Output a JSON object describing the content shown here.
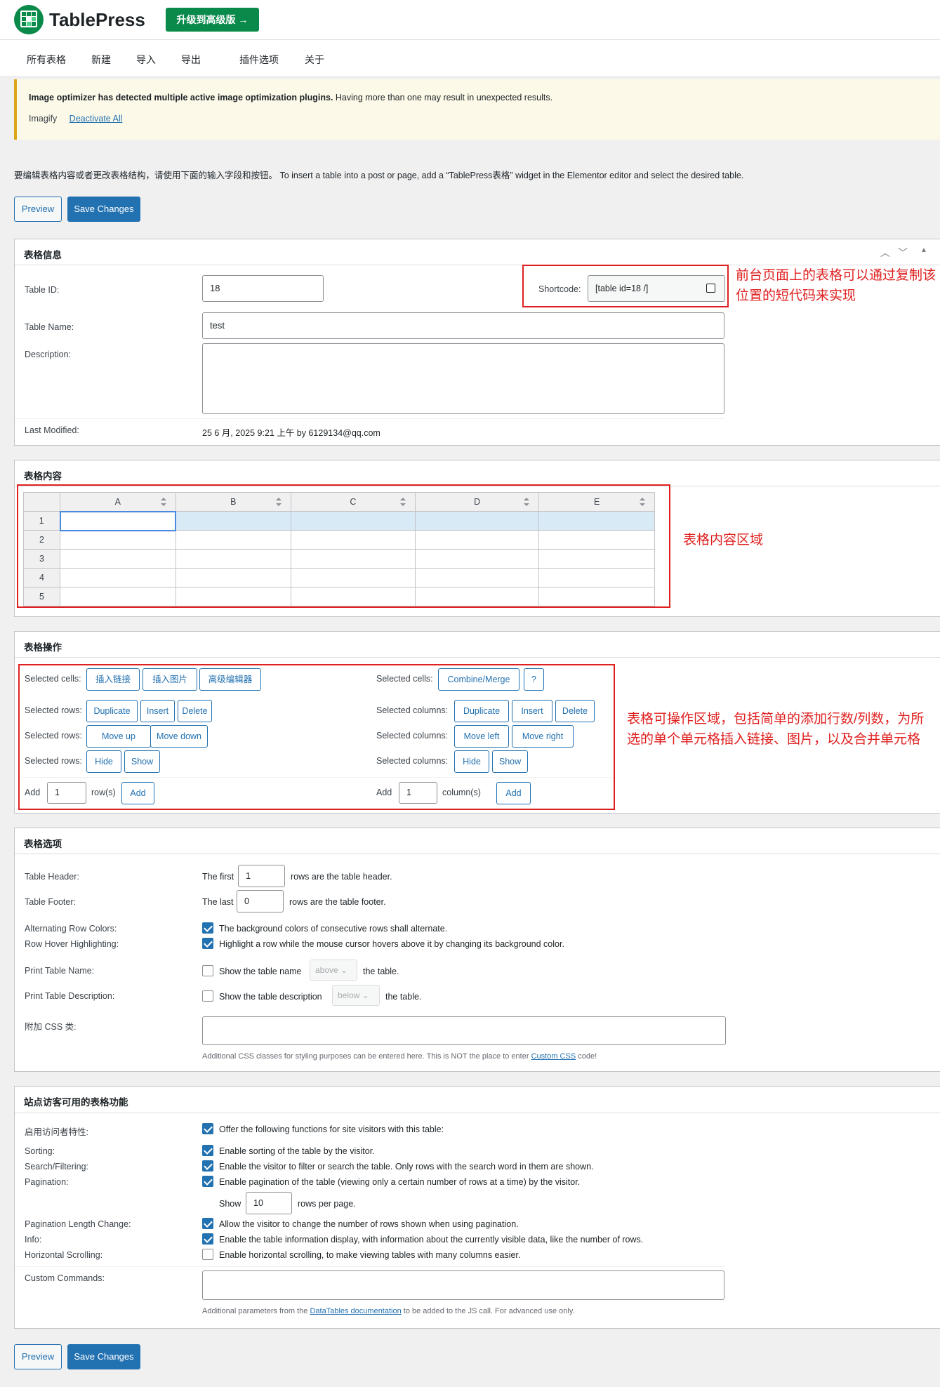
{
  "app": {
    "brand": "TablePress",
    "upgrade_label": "升级到高级版 →"
  },
  "nav": [
    "所有表格",
    "新建",
    "导入",
    "导出",
    "插件选项",
    "关于"
  ],
  "notice": {
    "bold": "Image optimizer has detected multiple active image optimization plugins.",
    "text": " Having more than one may result in unexpected results.",
    "plugin": "Imagify",
    "deactivate": "Deactivate All"
  },
  "intro": "要编辑表格内容或者更改表格结构，请使用下面的输入字段和按钮。 To insert a table into a post or page, add a “TablePress表格” widget in the Elementor editor and select the desired table.",
  "buttons": {
    "preview": "Preview",
    "save": "Save Changes"
  },
  "info": {
    "title": "表格信息",
    "id_label": "Table ID:",
    "id_value": "18",
    "shortcode_label": "Shortcode:",
    "shortcode_value": "[table id=18 /]",
    "name_label": "Table Name:",
    "name_value": "test",
    "desc_label": "Description:",
    "modified_label": "Last Modified:",
    "modified_value": "25 6 月, 2025 9:21 上午 by 6129134@qq.com",
    "annotation": "前台页面上的表格可以通过复制该位置的短代码来实现"
  },
  "content": {
    "title": "表格内容",
    "columns": [
      "A",
      "B",
      "C",
      "D",
      "E"
    ],
    "rows": [
      "1",
      "2",
      "3",
      "4",
      "5"
    ],
    "annotation": "表格内容区域"
  },
  "ops": {
    "title": "表格操作",
    "selected_cells": "Selected cells:",
    "selected_rows": "Selected rows:",
    "selected_columns": "Selected columns:",
    "insert_link": "插入链接",
    "insert_image": "插入图片",
    "advanced_editor": "高级编辑器",
    "combine": "Combine/Merge",
    "help": "?",
    "duplicate": "Duplicate",
    "insert": "Insert",
    "delete": "Delete",
    "move_up": "Move up",
    "move_down": "Move down",
    "move_left": "Move left",
    "move_right": "Move right",
    "hide": "Hide",
    "show": "Show",
    "add": "Add",
    "rows_value": "1",
    "cols_value": "1",
    "rows_suffix": "row(s)",
    "cols_suffix": "column(s)",
    "annotation": "表格可操作区域，包括简单的添加行数/列数，为所选的单个单元格插入链接、图片，以及合并单元格"
  },
  "options": {
    "title": "表格选项",
    "header_label": "Table Header:",
    "header_pre": "The first",
    "header_value": "1",
    "header_post": "rows are the table header.",
    "footer_label": "Table Footer:",
    "footer_pre": "The last",
    "footer_value": "0",
    "footer_post": "rows are the table footer.",
    "alt_label": "Alternating Row Colors:",
    "alt_text": "The background colors of consecutive rows shall alternate.",
    "hover_label": "Row Hover Highlighting:",
    "hover_text": "Highlight a row while the mouse cursor hovers above it by changing its background color.",
    "print_name_label": "Print Table Name:",
    "print_name_text": "Show the table name",
    "print_name_sel": "above",
    "print_name_post": "the table.",
    "print_desc_label": "Print Table Description:",
    "print_desc_text": "Show the table description",
    "print_desc_sel": "below",
    "print_desc_post": "the table.",
    "css_label": "附加 CSS 类:",
    "css_help": "Additional CSS classes for styling purposes can be entered here. This is NOT the place to enter ",
    "css_link": "Custom CSS",
    "css_help_end": " code!"
  },
  "visitor": {
    "title": "站点访客可用的表格功能",
    "enable_label": "启用访问者特性:",
    "enable_text": "Offer the following functions for site visitors with this table:",
    "sorting_label": "Sorting:",
    "sorting_text": "Enable sorting of the table by the visitor.",
    "search_label": "Search/Filtering:",
    "search_text": "Enable the visitor to filter or search the table. Only rows with the search word in them are shown.",
    "pag_label": "Pagination:",
    "pag_text": "Enable pagination of the table (viewing only a certain number of rows at a time) by the visitor.",
    "show_pre": "Show",
    "show_value": "10",
    "show_post": "rows per page.",
    "plc_label": "Pagination Length Change:",
    "plc_text": "Allow the visitor to change the number of rows shown when using pagination.",
    "info_label": "Info:",
    "info_text": "Enable the table information display, with information about the currently visible data, like the number of rows.",
    "hs_label": "Horizontal Scrolling:",
    "hs_text": "Enable horizontal scrolling, to make viewing tables with many columns easier.",
    "cmd_label": "Custom Commands:",
    "cmd_help": "Additional parameters from the ",
    "cmd_link": "DataTables documentation",
    "cmd_help_end": " to be added to the JS call. For advanced use only."
  },
  "colors": {
    "accent": "#2271b1",
    "brand": "#0a8a4a",
    "annotation": "#e02020"
  }
}
